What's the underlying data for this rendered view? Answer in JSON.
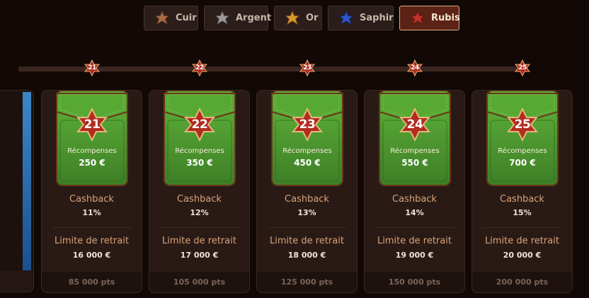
{
  "tabs": [
    {
      "label": "Cuir",
      "icon": "bronze-star-icon",
      "color": "#a86a45"
    },
    {
      "label": "Argent",
      "icon": "silver-star-icon",
      "color": "#9a9a9a"
    },
    {
      "label": "Or",
      "icon": "gold-star-icon",
      "color": "#d99a2c"
    },
    {
      "label": "Saphir",
      "icon": "sapphire-star-icon",
      "color": "#2c55c8"
    },
    {
      "label": "Rubis",
      "icon": "ruby-star-icon",
      "color": "#c0322a"
    }
  ],
  "active_tab": "Rubis",
  "track_markers": [
    "21",
    "22",
    "23",
    "24",
    "25"
  ],
  "cards": [
    {
      "level": "21",
      "reward_label": "Récompenses",
      "reward": "250 €",
      "cashback_label": "Cashback",
      "cashback": "11%",
      "limit_label": "Limite de retrait",
      "limit": "16 000 €",
      "points": "85 000 pts"
    },
    {
      "level": "22",
      "reward_label": "Récompenses",
      "reward": "350 €",
      "cashback_label": "Cashback",
      "cashback": "12%",
      "limit_label": "Limite de retrait",
      "limit": "17 000 €",
      "points": "105 000 pts"
    },
    {
      "level": "23",
      "reward_label": "Récompenses",
      "reward": "450 €",
      "cashback_label": "Cashback",
      "cashback": "13%",
      "limit_label": "Limite de retrait",
      "limit": "18 000 €",
      "points": "125 000 pts"
    },
    {
      "level": "24",
      "reward_label": "Récompenses",
      "reward": "550 €",
      "cashback_label": "Cashback",
      "cashback": "14%",
      "limit_label": "Limite de retrait",
      "limit": "19 000 €",
      "points": "150 000 pts"
    },
    {
      "level": "25",
      "reward_label": "Récompenses",
      "reward": "700 €",
      "cashback_label": "Cashback",
      "cashback": "15%",
      "limit_label": "Limite de retrait",
      "limit": "20 000 €",
      "points": "200 000 pts"
    }
  ],
  "colors": {
    "background": "#120806",
    "wallet_green": "#4a9a2e",
    "ruby_star": "#b22c20",
    "label_orange": "#d9a37a"
  }
}
